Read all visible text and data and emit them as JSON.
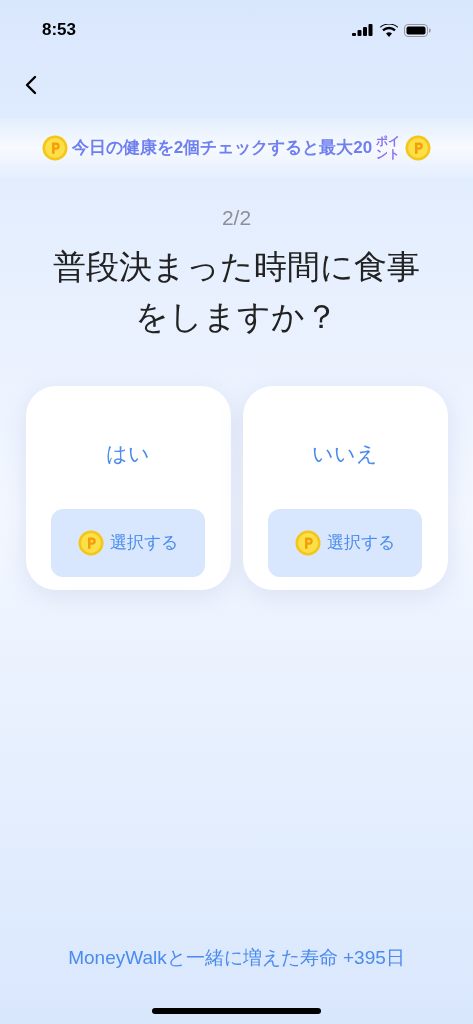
{
  "status_bar": {
    "time": "8:53"
  },
  "banner": {
    "text": "今日の健康を2個チェックすると最大20",
    "unit": "ポイント"
  },
  "progress": "2/2",
  "question": "普段決まった時間に食事をしますか？",
  "options": [
    {
      "label": "はい",
      "button": "選択する"
    },
    {
      "label": "いいえ",
      "button": "選択する"
    }
  ],
  "footer": "MoneyWalkと一緒に増えた寿命 +395日"
}
